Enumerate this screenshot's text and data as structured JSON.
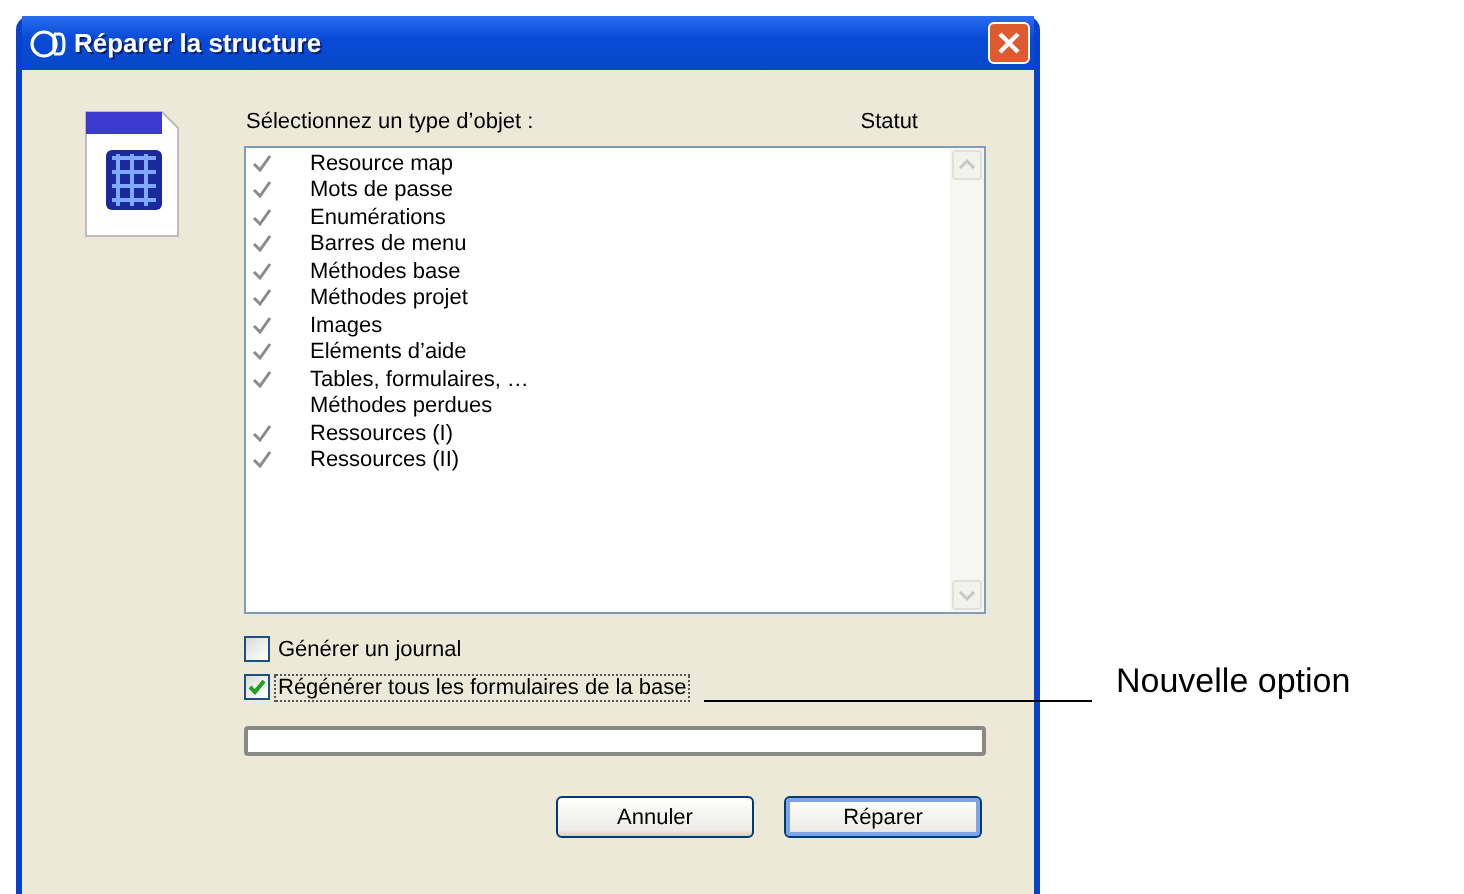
{
  "window": {
    "title": "Réparer la structure"
  },
  "list_label": "Sélectionnez un type d’objet :",
  "status_header": "Statut",
  "items": [
    {
      "label": "Resource map",
      "checked": true
    },
    {
      "label": "Mots de passe",
      "checked": true
    },
    {
      "label": "Enumérations",
      "checked": true
    },
    {
      "label": "Barres de menu",
      "checked": true
    },
    {
      "label": "Méthodes base",
      "checked": true
    },
    {
      "label": "Méthodes projet",
      "checked": true
    },
    {
      "label": "Images",
      "checked": true
    },
    {
      "label": "Eléments d’aide",
      "checked": true
    },
    {
      "label": "Tables, formulaires, …",
      "checked": true
    },
    {
      "label": "Méthodes perdues",
      "checked": false
    },
    {
      "label": "Ressources (I)",
      "checked": true
    },
    {
      "label": "Ressources (II)",
      "checked": true
    }
  ],
  "options": [
    {
      "label": "Générer un journal",
      "checked": false,
      "focused": false
    },
    {
      "label": "Régénérer tous les formulaires de la base",
      "checked": true,
      "focused": true
    }
  ],
  "buttons": [
    {
      "label": "Annuler",
      "default": false
    },
    {
      "label": "Réparer",
      "default": true
    }
  ],
  "annotation": "Nouvelle option"
}
